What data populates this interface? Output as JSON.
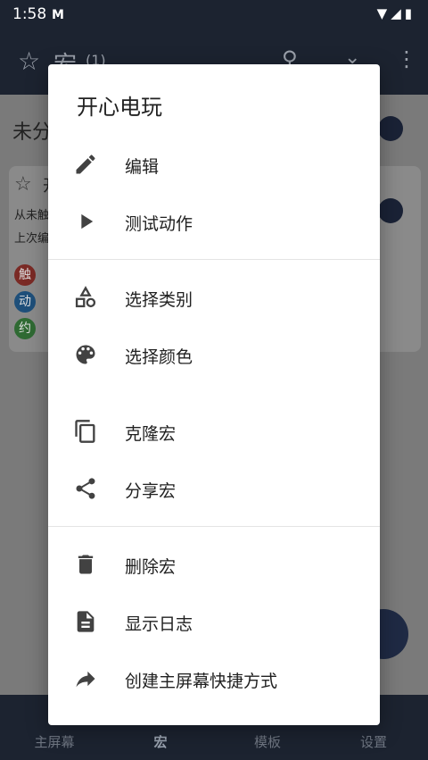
{
  "status_bar": {
    "time": "1:58",
    "app_icon": "M",
    "icons": [
      "wifi-icon",
      "signal-icon",
      "battery-icon"
    ]
  },
  "app_bar": {
    "title": "宏",
    "count": "(1)"
  },
  "main": {
    "category": "未分",
    "card": {
      "name": "开",
      "line1": "从未触",
      "line2": "上次编",
      "badges": [
        "触",
        "动",
        "约"
      ]
    }
  },
  "nav": {
    "items": [
      "主屏幕",
      "宏",
      "模板",
      "设置"
    ]
  },
  "dialog": {
    "title": "开心电玩",
    "items": [
      {
        "label": "编辑",
        "icon": "pencil-icon"
      },
      {
        "label": "测试动作",
        "icon": "play-icon"
      },
      {
        "label": "选择类别",
        "icon": "category-shapes-icon"
      },
      {
        "label": "选择颜色",
        "icon": "palette-icon"
      },
      {
        "label": "克隆宏",
        "icon": "copy-icon"
      },
      {
        "label": "分享宏",
        "icon": "share-icon"
      },
      {
        "label": "删除宏",
        "icon": "trash-icon"
      },
      {
        "label": "显示日志",
        "icon": "document-icon"
      },
      {
        "label": "创建主屏幕快捷方式",
        "icon": "shortcut-arrow-icon"
      }
    ]
  }
}
